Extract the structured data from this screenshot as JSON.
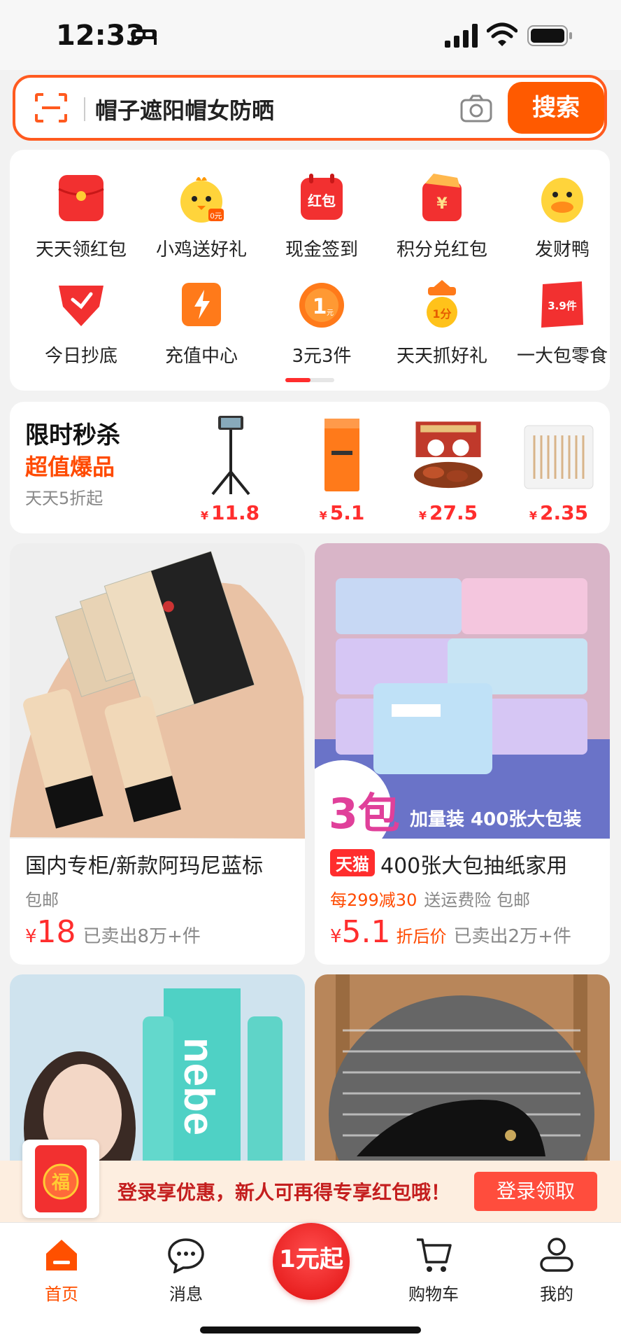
{
  "status_bar": {
    "time": "12:33"
  },
  "search": {
    "query": "帽子遮阳帽女防晒",
    "button": "搜索"
  },
  "shortcuts": {
    "row1": [
      {
        "label": "天天领红包",
        "icon": "red-envelope-icon"
      },
      {
        "label": "小鸡送好礼",
        "icon": "chick-icon"
      },
      {
        "label": "现金签到",
        "icon": "calendar-hongbao-icon"
      },
      {
        "label": "积分兑红包",
        "icon": "yuan-envelope-icon"
      },
      {
        "label": "发财鸭",
        "icon": "duck-icon"
      }
    ],
    "row2": [
      {
        "label": "今日抄底",
        "icon": "down-arrow-bird-icon"
      },
      {
        "label": "充值中心",
        "icon": "lightning-icon"
      },
      {
        "label": "3元3件",
        "icon": "coin-1yuan-icon"
      },
      {
        "label": "天天抓好礼",
        "icon": "claw-1fen-icon"
      },
      {
        "label": "一大包零食",
        "icon": "snack-bag-icon"
      }
    ],
    "icon_labels": {
      "calendar": "红包",
      "coin": "1",
      "coin_unit": "元",
      "claw": "1分",
      "snack": "3.9件"
    }
  },
  "flash_sale": {
    "title": "限时秒杀",
    "subtitle": "超值爆品",
    "caption": "天天5折起",
    "items": [
      {
        "name": "selfie-stick",
        "price": "11.8"
      },
      {
        "name": "tissue-box",
        "price": "5.1"
      },
      {
        "name": "snack-gift-box",
        "price": "27.5"
      },
      {
        "name": "cotton-swabs",
        "price": "2.35"
      }
    ],
    "currency": "¥"
  },
  "products": [
    {
      "title": "国内专柜/新款阿玛尼蓝标",
      "meta": [
        "包邮"
      ],
      "currency": "¥",
      "price": "18",
      "sold": "已卖出8万+件"
    },
    {
      "badge": "天猫",
      "title": "400张大包抽纸家用",
      "promo": "每299减30",
      "meta": [
        "送运费险",
        "包邮"
      ],
      "currency": "¥",
      "price": "5.1",
      "price_note": "折后价",
      "sold": "已卖出2万+件",
      "overlay_count": "3包",
      "overlay_text": "加量装 400张大包装"
    }
  ],
  "login_banner": {
    "text": "登录享优惠，新人可再得专享红包哦！",
    "button": "登录领取",
    "envelope_char": "福"
  },
  "tabbar": {
    "items": [
      {
        "label": "首页",
        "icon": "home-icon",
        "active": true
      },
      {
        "label": "消息",
        "icon": "message-icon"
      },
      {
        "label": "1元起",
        "icon": "promo-badge"
      },
      {
        "label": "购物车",
        "icon": "cart-icon"
      },
      {
        "label": "我的",
        "icon": "profile-icon"
      }
    ]
  },
  "colors": {
    "accent": "#ff5000",
    "price": "#ff2d2d",
    "banner_bg": "#fdeee0"
  }
}
